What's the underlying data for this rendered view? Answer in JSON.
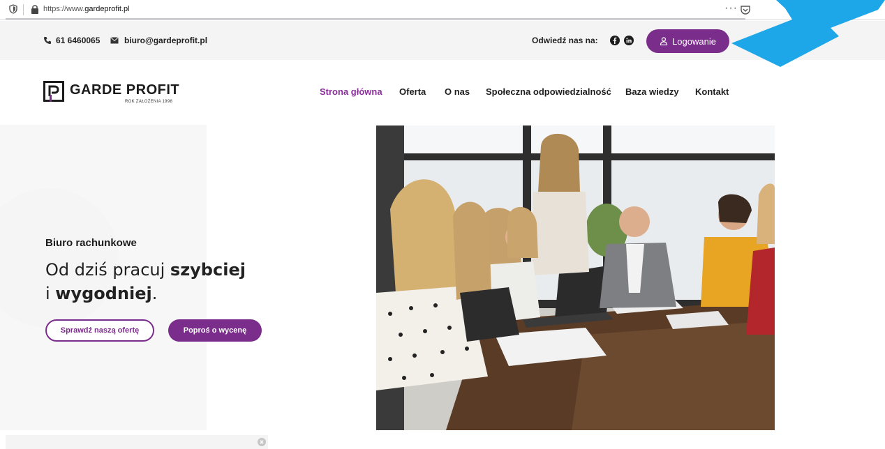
{
  "browser": {
    "url_prefix": "https://www.",
    "url_domain": "gardeprofit.pl",
    "menu_dots": "···"
  },
  "topbar": {
    "phone": "61 6460065",
    "email": "biuro@gardeprofit.pl",
    "visit_label": "Odwiedź nas na:",
    "login_label": "Logowanie"
  },
  "logo": {
    "name": "GARDE PROFIT",
    "subtitle": "ROK ZAŁOŻENIA 1998"
  },
  "nav": {
    "items": [
      {
        "label": "Strona główna"
      },
      {
        "label": "Oferta"
      },
      {
        "label": "O nas"
      },
      {
        "label": "Społeczna odpowiedzialność"
      },
      {
        "label": "Baza wiedzy"
      },
      {
        "label": "Kontakt"
      }
    ]
  },
  "hero": {
    "subtitle": "Biuro rachunkowe",
    "line1_normal": "Od dziś pracuj ",
    "line1_bold": "szybciej",
    "line2_normal": "i ",
    "line2_bold": "wygodniej",
    "line2_end": ".",
    "button_offer": "Sprawdź naszą ofertę",
    "button_quote": "Poproś o wycenę"
  },
  "colors": {
    "brand_purple": "#7b2d8b",
    "annotation_arrow": "#1ea7e8"
  }
}
